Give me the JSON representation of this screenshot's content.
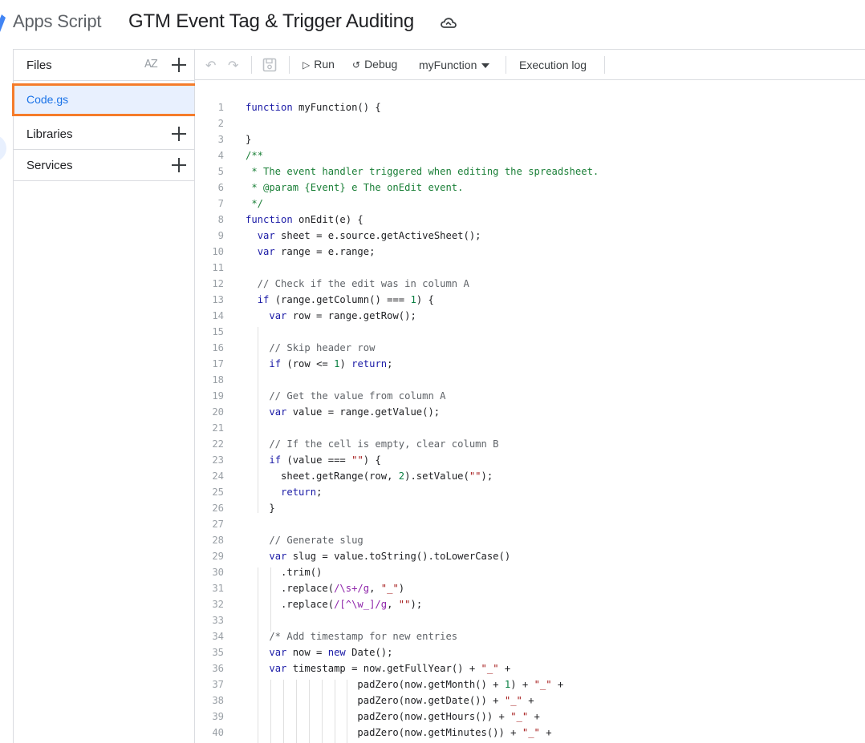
{
  "header": {
    "app_name": "Apps Script",
    "project_title": "GTM Event Tag & Trigger Auditing",
    "icons": [
      "apps-script-logo-icon",
      "cloud-saved-icon"
    ]
  },
  "sidebar": {
    "files_label": "Files",
    "sort_icon_text": "AZ",
    "file_name": "Code.gs",
    "libraries_label": "Libraries",
    "services_label": "Services"
  },
  "toolbar": {
    "run_label": "Run",
    "debug_label": "Debug",
    "function_selected": "myFunction",
    "execution_log_label": "Execution log"
  },
  "colors": {
    "highlight": "#f57c2b",
    "selected_bg": "#e8f0fe",
    "link_blue": "#1a73e8"
  },
  "editor": {
    "lines": [
      {
        "n": "1",
        "text": "function myFunction() {"
      },
      {
        "n": "2",
        "text": ""
      },
      {
        "n": "3",
        "text": "}"
      },
      {
        "n": "4",
        "text": "/**"
      },
      {
        "n": "5",
        "text": " * The event handler triggered when editing the spreadsheet."
      },
      {
        "n": "6",
        "text": " * @param {Event} e The onEdit event."
      },
      {
        "n": "7",
        "text": " */"
      },
      {
        "n": "8",
        "text": "function onEdit(e) {"
      },
      {
        "n": "9",
        "text": "  var sheet = e.source.getActiveSheet();"
      },
      {
        "n": "10",
        "text": "  var range = e.range;"
      },
      {
        "n": "11",
        "text": ""
      },
      {
        "n": "12",
        "text": "  // Check if the edit was in column A"
      },
      {
        "n": "13",
        "text": "  if (range.getColumn() === 1) {"
      },
      {
        "n": "14",
        "text": "    var row = range.getRow();"
      },
      {
        "n": "15",
        "text": ""
      },
      {
        "n": "16",
        "text": "    // Skip header row"
      },
      {
        "n": "17",
        "text": "    if (row <= 1) return;"
      },
      {
        "n": "18",
        "text": ""
      },
      {
        "n": "19",
        "text": "    // Get the value from column A"
      },
      {
        "n": "20",
        "text": "    var value = range.getValue();"
      },
      {
        "n": "21",
        "text": ""
      },
      {
        "n": "22",
        "text": "    // If the cell is empty, clear column B"
      },
      {
        "n": "23",
        "text": "    if (value === \"\") {"
      },
      {
        "n": "24",
        "text": "      sheet.getRange(row, 2).setValue(\"\");"
      },
      {
        "n": "25",
        "text": "      return;"
      },
      {
        "n": "26",
        "text": "    }"
      },
      {
        "n": "27",
        "text": ""
      },
      {
        "n": "28",
        "text": "    // Generate slug"
      },
      {
        "n": "29",
        "text": "    var slug = value.toString().toLowerCase()"
      },
      {
        "n": "30",
        "text": "      .trim()"
      },
      {
        "n": "31",
        "text": "      .replace(/\\s+/g, \"_\")"
      },
      {
        "n": "32",
        "text": "      .replace(/[^\\w_]/g, \"\");"
      },
      {
        "n": "33",
        "text": ""
      },
      {
        "n": "34",
        "text": "    /* Add timestamp for new entries"
      },
      {
        "n": "35",
        "text": "    var now = new Date();"
      },
      {
        "n": "36",
        "text": "    var timestamp = now.getFullYear() + \"_\" +"
      },
      {
        "n": "37",
        "text": "                   padZero(now.getMonth() + 1) + \"_\" +"
      },
      {
        "n": "38",
        "text": "                   padZero(now.getDate()) + \"_\" +"
      },
      {
        "n": "39",
        "text": "                   padZero(now.getHours()) + \"_\" +"
      },
      {
        "n": "40",
        "text": "                   padZero(now.getMinutes()) + \"_\" +"
      }
    ]
  }
}
